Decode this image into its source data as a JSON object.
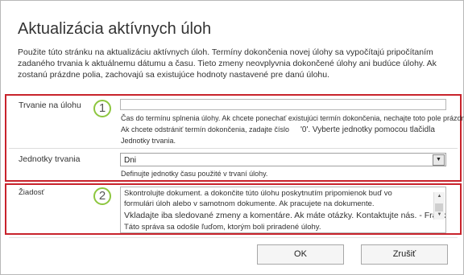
{
  "dialog": {
    "title": "Aktualizácia aktívnych úloh",
    "intro": "Použite túto stránku na aktualizáciu aktívnych úloh. Termíny dokončenia novej úlohy sa vypočítajú pripočítaním zadaného trvania k aktuálnemu dátumu a času. Tieto zmeny neovplyvnia dokončené úlohy ani budúce úlohy. Ak zostanú prázdne polia, zachovajú sa existujúce hodnoty nastavené pre danú úlohu."
  },
  "duration": {
    "label": "Trvanie na úlohu",
    "callout": "1",
    "value": "",
    "hint_line1": "Čas do termínu splnenia úlohy. Ak chcete ponechať existujúci termín dokončenia, nechajte toto pole prázdne.",
    "hint_line2a": "Ak chcete odstrániť termín dokončenia, zadajte číslo",
    "hint_line2b": "'0'. Vyberte jednotky pomocou tlačidla",
    "hint_line3": "Jednotky trvania."
  },
  "units": {
    "label": "Jednotky trvania",
    "selected": "Dni",
    "hint": "Definujte jednotky času použité v trvaní úlohy."
  },
  "request": {
    "label": "Žiadosť",
    "callout": "2",
    "line1": "Skontrolujte dokument. a dokončite túto úlohu poskytnutím pripomienok buď vo",
    "line2": "formulári úloh alebo v samotnom dokumente. Ak pracujete na dokumente.",
    "line3": "Vkladajte iba sledované zmeny a komentáre. Ak máte otázky. Kontaktujte nás. - Frank",
    "line4": "Táto správa sa odošle ľuďom, ktorým boli priradené úlohy."
  },
  "buttons": {
    "ok": "OK",
    "cancel": "Zrušiť"
  }
}
